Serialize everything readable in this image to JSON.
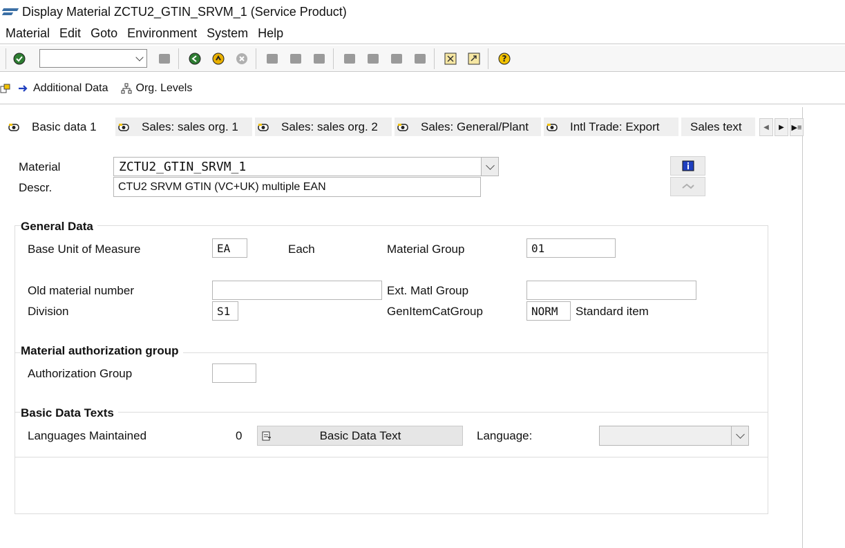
{
  "window": {
    "title": "Display Material ZCTU2_GTIN_SRVM_1 (Service Product)"
  },
  "menu": [
    "Material",
    "Edit",
    "Goto",
    "Environment",
    "System",
    "Help"
  ],
  "command_field": {
    "value": ""
  },
  "app_toolbar": {
    "additional_data": "Additional Data",
    "org_levels": "Org. Levels"
  },
  "tabs": [
    "Basic data 1",
    "Sales: sales org. 1",
    "Sales: sales org. 2",
    "Sales: General/Plant",
    "Intl Trade: Export",
    "Sales text"
  ],
  "header": {
    "material_label": "Material",
    "material_value": "ZCTU2_GTIN_SRVM_1",
    "descr_label": "Descr.",
    "descr_value": "CTU2 SRVM GTIN (VC+UK) multiple EAN"
  },
  "general_data": {
    "title": "General Data",
    "base_uom_label": "Base Unit of Measure",
    "base_uom_value": "EA",
    "base_uom_text": "Each",
    "material_group_label": "Material Group",
    "material_group_value": "01",
    "old_material_label": "Old material number",
    "old_material_value": "",
    "ext_matl_group_label": "Ext. Matl Group",
    "ext_matl_group_value": "",
    "division_label": "Division",
    "division_value": "S1",
    "gen_item_cat_label": "GenItemCatGroup",
    "gen_item_cat_value": "NORM",
    "gen_item_cat_text": "Standard item"
  },
  "auth_group": {
    "title": "Material authorization group",
    "label": "Authorization Group",
    "value": ""
  },
  "basic_texts": {
    "title": "Basic Data Texts",
    "languages_label": "Languages Maintained",
    "languages_count": "0",
    "button_label": "Basic Data Text",
    "language_label": "Language:",
    "language_value": ""
  },
  "colors": {
    "accent": "#3b6fa5",
    "info_blue": "#1f3fbf",
    "tab_bg": "#efefef"
  }
}
